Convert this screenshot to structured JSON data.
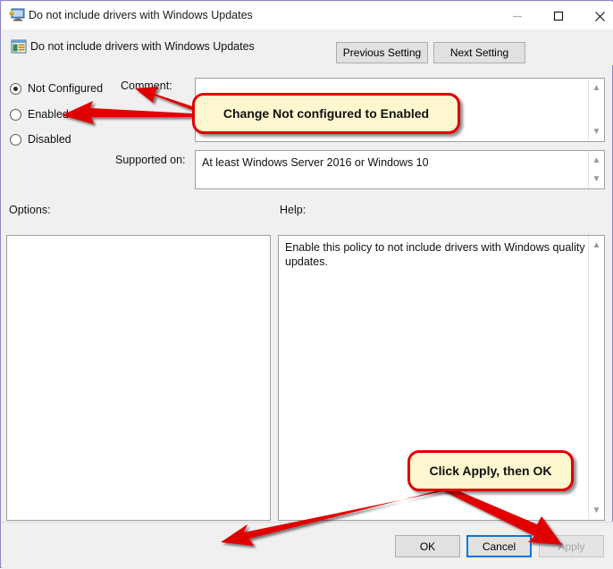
{
  "window": {
    "title": "Do not include drivers with Windows Updates",
    "title_icon": "computer-monitor-icon",
    "minimize_label": "–",
    "maximize_label": "□",
    "close_label": "✕"
  },
  "header": {
    "policy_icon": "policy-setting-icon",
    "policy_name": "Do not include drivers with Windows Updates",
    "previous_setting_label": "Previous Setting",
    "next_setting_label": "Next Setting"
  },
  "state_options": [
    {
      "label": "Not Configured",
      "selected": true
    },
    {
      "label": "Enabled",
      "selected": false
    },
    {
      "label": "Disabled",
      "selected": false
    }
  ],
  "comment": {
    "label": "Comment:",
    "value": ""
  },
  "supported_on": {
    "label": "Supported on:",
    "value": "At least Windows Server 2016 or Windows 10"
  },
  "options": {
    "label": "Options:",
    "value": ""
  },
  "help": {
    "label": "Help:",
    "value": "Enable this policy to not include drivers with Windows quality updates."
  },
  "buttons": {
    "ok_label": "OK",
    "cancel_label": "Cancel",
    "apply_label": "Apply"
  },
  "annotations": {
    "callout_radio": "Change Not configured to Enabled",
    "callout_buttons": "Click Apply, then OK",
    "callout_fill": "#fdf7cf",
    "callout_border": "#e00000",
    "arrow_color": "#e00000"
  }
}
